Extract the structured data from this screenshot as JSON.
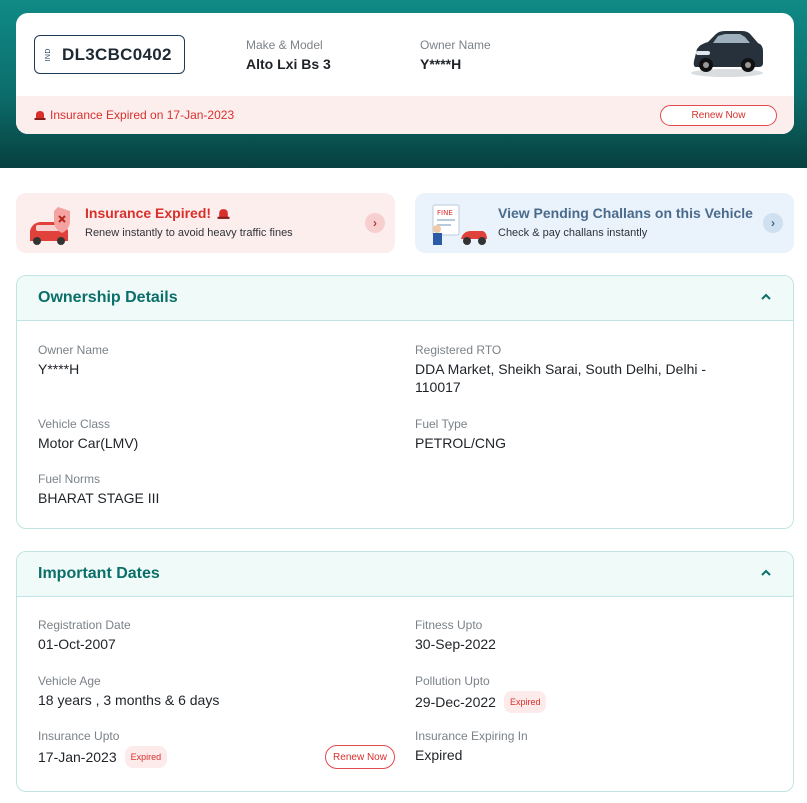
{
  "vehicle": {
    "plate_country": "IND",
    "plate_number": "DL3CBC0402",
    "make_model_label": "Make & Model",
    "make_model_value": "Alto Lxi Bs 3",
    "owner_label": "Owner Name",
    "owner_value": "Y****H",
    "insurance_notice": "Insurance Expired on 17-Jan-2023",
    "renew_label": "Renew Now"
  },
  "promos": [
    {
      "title": "Insurance Expired!",
      "subtitle": "Renew instantly to avoid heavy traffic fines"
    },
    {
      "title": "View Pending Challans on this Vehicle",
      "subtitle": "Check & pay challans instantly"
    }
  ],
  "ownership": {
    "title": "Ownership Details",
    "fields": [
      {
        "label": "Owner Name",
        "value": "Y****H"
      },
      {
        "label": "Registered RTO",
        "value": "DDA Market, Sheikh Sarai, South Delhi, Delhi - 110017"
      },
      {
        "label": "Vehicle Class",
        "value": "Motor Car(LMV)"
      },
      {
        "label": "Fuel Type",
        "value": "PETROL/CNG"
      },
      {
        "label": "Fuel Norms",
        "value": "BHARAT STAGE III"
      }
    ]
  },
  "dates": {
    "title": "Important Dates",
    "fields": [
      {
        "label": "Registration Date",
        "value": "01-Oct-2007"
      },
      {
        "label": "Fitness Upto",
        "value": "30-Sep-2022"
      },
      {
        "label": "Vehicle Age",
        "value": "18 years , 3 months & 6 days"
      },
      {
        "label": "Pollution Upto",
        "value": "29-Dec-2022",
        "badge": "Expired"
      },
      {
        "label": "Insurance Upto",
        "value": "17-Jan-2023",
        "badge": "Expired"
      },
      {
        "label": "Insurance Expiring In",
        "value": "Expired"
      }
    ],
    "renew_label": "Renew Now"
  },
  "colors": {
    "brand_teal": "#0c6e6c",
    "alert_red": "#d9302c",
    "section_border": "#bfe5e2"
  },
  "icons": [
    "siren-icon",
    "chevron-right-icon",
    "chevron-up-icon",
    "car-icon",
    "shield-x-icon",
    "fine-illustration-icon"
  ]
}
